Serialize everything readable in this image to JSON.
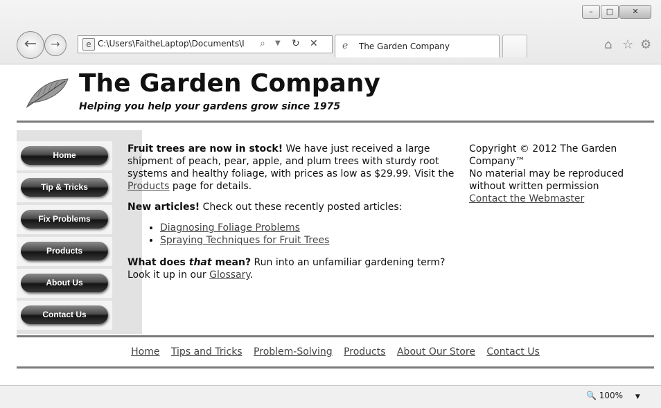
{
  "browser": {
    "window_controls": {
      "minimize": "–",
      "maximize": "□",
      "close": "✕"
    },
    "address_bar": {
      "url": "C:\\Users\\FaitheLaptop\\Documents\\I"
    },
    "tab": {
      "title": "The Garden Company"
    },
    "icons": [
      "back-arrow-icon",
      "forward-arrow-icon",
      "page-icon",
      "search-icon",
      "dropdown-icon",
      "refresh-icon",
      "stop-icon",
      "ie-logo-icon",
      "home-icon",
      "favorites-star-icon",
      "settings-gear-icon",
      "zoom-icon"
    ],
    "status": {
      "zoom": "100%"
    }
  },
  "header": {
    "title": "The Garden Company",
    "tagline": "Helping you help your gardens grow since 1975"
  },
  "sidebar": {
    "items": [
      {
        "label": "Home"
      },
      {
        "label": "Tip & Tricks"
      },
      {
        "label": "Fix Problems"
      },
      {
        "label": "Products"
      },
      {
        "label": "About Us"
      },
      {
        "label": "Contact Us"
      }
    ]
  },
  "main": {
    "p1": {
      "bold": "Fruit trees are now in stock!",
      "text1": " We have just received a large shipment of peach, pear, apple, and plum trees with sturdy root systems and healthy foliage, with prices as low as $29.99. Visit the ",
      "link": "Products",
      "text2": " page for details."
    },
    "p2": {
      "bold": "New articles!",
      "text": " Check out these recently posted articles:"
    },
    "articles": [
      "Diagnosing Foliage Problems",
      "Spraying Techniques for Fruit Trees"
    ],
    "p3": {
      "bold1": "What does ",
      "italic": "that",
      "bold2": " mean?",
      "text1": " Run into an unfamiliar gardening term? Look it up in our ",
      "link": "Glossary",
      "text2": "."
    }
  },
  "aside": {
    "copyright": "Copyright © 2012 The Garden Company™",
    "notice": "No material may be reproduced without written permission",
    "contact_link": "Contact the Webmaster"
  },
  "footer": {
    "links": [
      "Home",
      "Tips and Tricks",
      "Problem-Solving",
      "Products",
      "About Our Store",
      "Contact Us"
    ]
  }
}
